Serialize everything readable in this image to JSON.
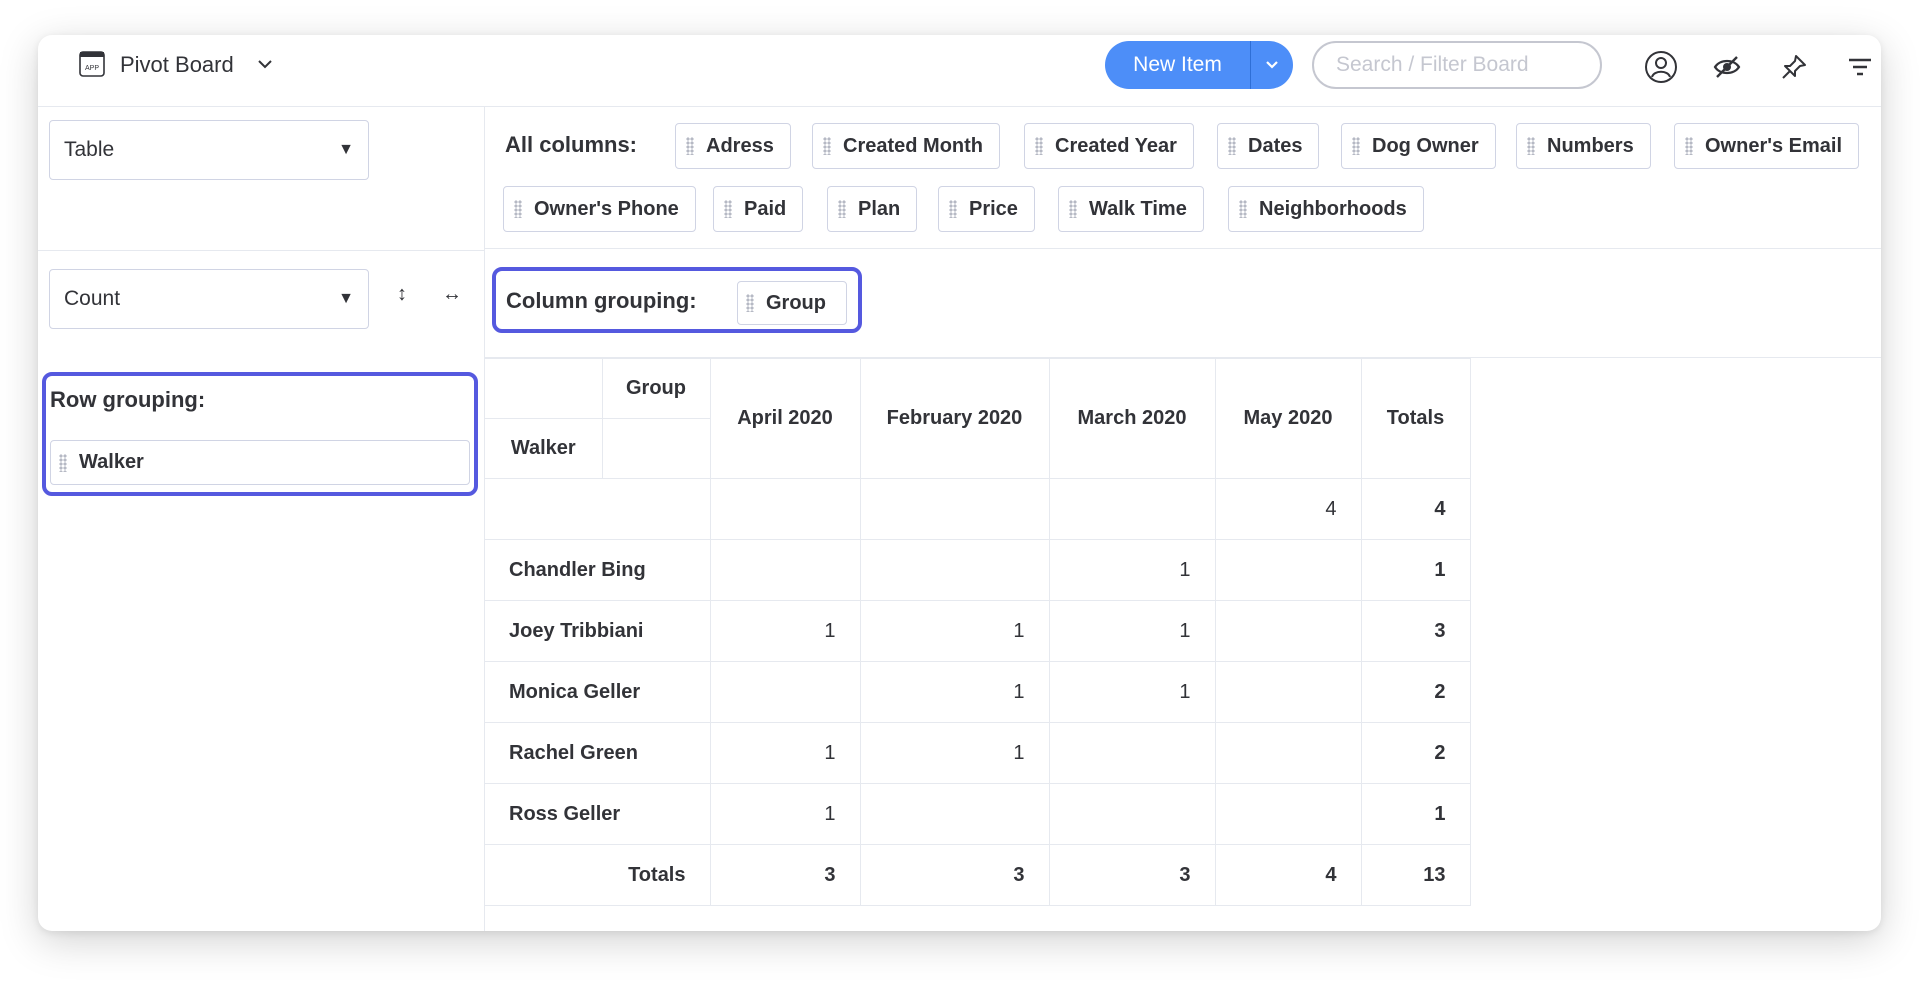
{
  "header": {
    "app_icon_text": "APP",
    "board_title": "Pivot Board",
    "new_item_label": "New Item",
    "search_placeholder": "Search / Filter Board"
  },
  "left": {
    "view_select": "Table",
    "aggregate_select": "Count",
    "vertical_icon": "↕",
    "horizontal_icon": "↔",
    "row_grouping_title": "Row grouping:",
    "row_grouping_field": "Walker"
  },
  "columns": {
    "label": "All columns:",
    "chips": [
      "Adress",
      "Created Month",
      "Created Year",
      "Dates",
      "Dog Owner",
      "Numbers",
      "Owner's Email",
      "Owner's Phone",
      "Paid",
      "Plan",
      "Price",
      "Walk Time",
      "Neighborhoods"
    ]
  },
  "column_grouping": {
    "title": "Column grouping:",
    "field": "Group"
  },
  "table": {
    "corner_col": "Group",
    "corner_row": "Walker",
    "headers": [
      "April 2020",
      "February 2020",
      "March 2020",
      "May 2020",
      "Totals"
    ],
    "rows": [
      {
        "name": "",
        "values": [
          "",
          "",
          "",
          "4"
        ],
        "total": "4"
      },
      {
        "name": "Chandler Bing",
        "values": [
          "",
          "",
          "1",
          ""
        ],
        "total": "1"
      },
      {
        "name": "Joey Tribbiani",
        "values": [
          "1",
          "1",
          "1",
          ""
        ],
        "total": "3"
      },
      {
        "name": "Monica Geller",
        "values": [
          "",
          "1",
          "1",
          ""
        ],
        "total": "2"
      },
      {
        "name": "Rachel Green",
        "values": [
          "1",
          "1",
          "",
          ""
        ],
        "total": "2"
      },
      {
        "name": "Ross Geller",
        "values": [
          "1",
          "",
          "",
          ""
        ],
        "total": "1"
      }
    ],
    "totals_label": "Totals",
    "totals": [
      "3",
      "3",
      "3",
      "4"
    ],
    "grand_total": "13"
  },
  "colors": {
    "accent": "#4d8ef8",
    "highlight": "#5559df",
    "border": "#e6e9ef"
  }
}
